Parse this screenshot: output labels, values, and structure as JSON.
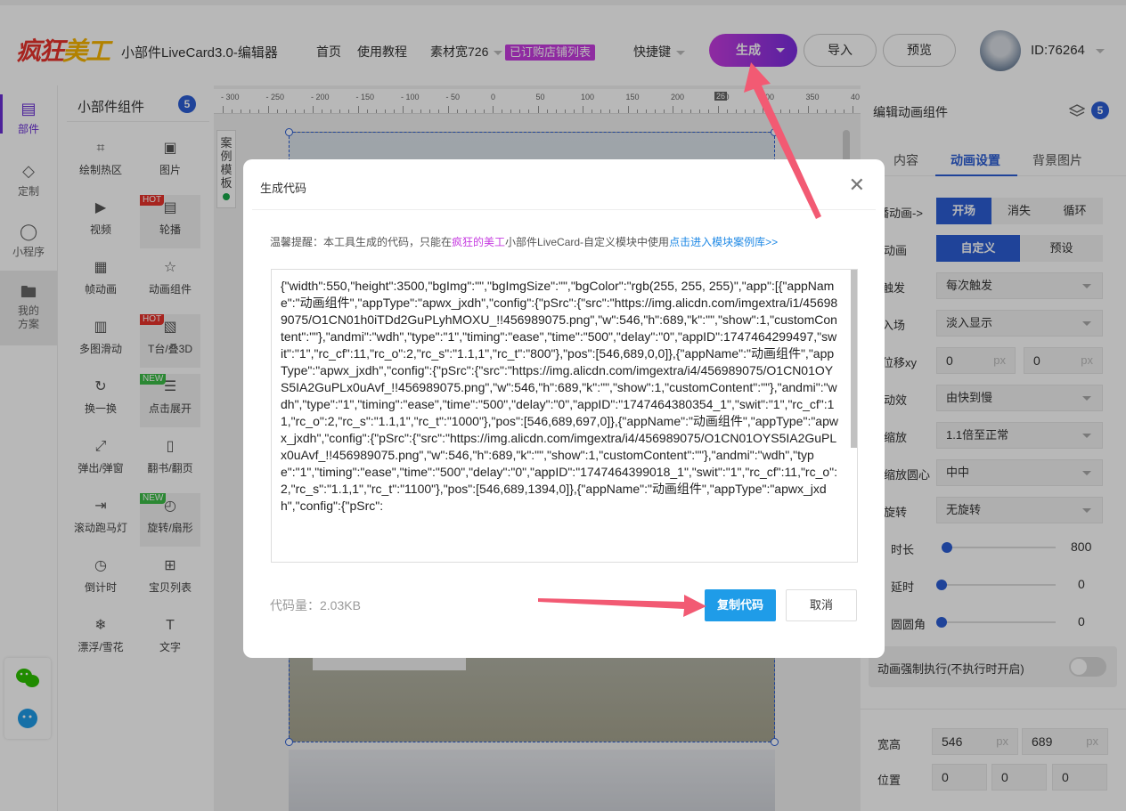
{
  "header": {
    "logo_text_a": "疯狂",
    "logo_text_b": "美工",
    "app_title": "小部件LiveCard3.0-编辑器",
    "nav": [
      "首页",
      "使用教程",
      "素材宽726"
    ],
    "subscribed_badge": "已订购店铺列表",
    "shortcut": "快捷键",
    "generate_label": "生成",
    "import_label": "导入",
    "preview_label": "预览",
    "user_id": "ID:76264"
  },
  "leftnav": {
    "items": [
      {
        "label": "部件",
        "icon": "widget-grid-icon"
      },
      {
        "label": "定制",
        "icon": "diamond-icon"
      },
      {
        "label": "小程序",
        "icon": "miniprogram-icon"
      },
      {
        "label": "我的方案",
        "icon": "folder-icon"
      }
    ]
  },
  "widgets": {
    "title": "小部件组件",
    "count": "5",
    "items": [
      {
        "label": "绘制热区",
        "icon": "hotspot-icon",
        "tag": ""
      },
      {
        "label": "图片",
        "icon": "image-icon",
        "tag": ""
      },
      {
        "label": "视频",
        "icon": "video-icon",
        "tag": ""
      },
      {
        "label": "轮播",
        "icon": "carousel-icon",
        "tag": "HOT"
      },
      {
        "label": "帧动画",
        "icon": "frame-animation-icon",
        "tag": ""
      },
      {
        "label": "动画组件",
        "icon": "star-icon",
        "tag": ""
      },
      {
        "label": "多图滑动",
        "icon": "multi-slide-icon",
        "tag": ""
      },
      {
        "label": "T台/叠3D",
        "icon": "stage-3d-icon",
        "tag": "HOT"
      },
      {
        "label": "换一换",
        "icon": "refresh-icon",
        "tag": ""
      },
      {
        "label": "点击展开",
        "icon": "expand-icon",
        "tag": "NEW"
      },
      {
        "label": "弹出/弹窗",
        "icon": "popup-icon",
        "tag": ""
      },
      {
        "label": "翻书/翻页",
        "icon": "book-icon",
        "tag": ""
      },
      {
        "label": "滚动跑马灯",
        "icon": "marquee-icon",
        "tag": ""
      },
      {
        "label": "旋转/扇形",
        "icon": "rotate-icon",
        "tag": "NEW"
      },
      {
        "label": "倒计时",
        "icon": "clock-icon",
        "tag": ""
      },
      {
        "label": "宝贝列表",
        "icon": "product-list-icon",
        "tag": ""
      },
      {
        "label": "漂浮/雪花",
        "icon": "snowflake-icon",
        "tag": ""
      },
      {
        "label": "文字",
        "icon": "text-icon",
        "tag": ""
      }
    ]
  },
  "ruler": {
    "ticks": [
      "- 300",
      "- 250",
      "- 200",
      "- 150",
      "- 100",
      "- 50",
      "0",
      "50",
      "100",
      "150",
      "200",
      "250",
      "300",
      "350",
      "40"
    ],
    "marker": "26"
  },
  "side_tab": "案例模板",
  "right": {
    "title": "编辑动画组件",
    "count": "5",
    "tabs": [
      "内容",
      "动画设置",
      "背景图片"
    ],
    "rows": [
      {
        "label": "播动画->",
        "seg": [
          "开场",
          "消失",
          "循环"
        ]
      },
      {
        "label": "动画",
        "seg": [
          "自定义",
          "预设"
        ]
      },
      {
        "label": "触发",
        "select": "每次触发"
      },
      {
        "label": "入场",
        "select": "淡入显示"
      },
      {
        "label": "位移xy",
        "x": "0",
        "y": "0",
        "unit": "px"
      },
      {
        "label": "动效",
        "select": "由快到慢"
      },
      {
        "label": "缩放",
        "select": "1.1倍至正常"
      },
      {
        "label": "缩放圆心",
        "select": "中中"
      },
      {
        "label": "旋转",
        "select": "无旋转"
      },
      {
        "label": "时长",
        "value": "800"
      },
      {
        "label": "延时",
        "value": "0"
      },
      {
        "label": "圆圆角",
        "value": "0"
      }
    ],
    "force_label": "动画强制执行(不执行时开启)",
    "size_label": "宽高",
    "width": "546",
    "height": "689",
    "pos_label": "位置",
    "pos": [
      "0",
      "0",
      "0"
    ]
  },
  "modal": {
    "title": "生成代码",
    "tip_prefix": "温馨提醒：本工具生成的代码，只能在",
    "tip_brand": "疯狂的美工",
    "tip_middle": "小部件LiveCard-自定义模块中使用",
    "tip_link": "点击进入模块案例库>>",
    "code": "{\"width\":550,\"height\":3500,\"bgImg\":\"\",\"bgImgSize\":\"\",\"bgColor\":\"rgb(255, 255, 255)\",\"app\":[{\"appName\":\"动画组件\",\"appType\":\"apwx_jxdh\",\"config\":{\"pSrc\":{\"src\":\"https://img.alicdn.com/imgextra/i1/456989075/O1CN01h0iTDd2GuPLyhMOXU_!!456989075.png\",\"w\":546,\"h\":689,\"k\":\"\",\"show\":1,\"customContent\":\"\"},\"andmi\":\"wdh\",\"type\":\"1\",\"timing\":\"ease\",\"time\":\"500\",\"delay\":\"0\",\"appID\":1747464299497,\"swit\":\"1\",\"rc_cf\":11,\"rc_o\":2,\"rc_s\":\"1.1,1\",\"rc_t\":\"800\"},\"pos\":[546,689,0,0]},{\"appName\":\"动画组件\",\"appType\":\"apwx_jxdh\",\"config\":{\"pSrc\":{\"src\":\"https://img.alicdn.com/imgextra/i4/456989075/O1CN01OYS5IA2GuPLx0uAvf_!!456989075.png\",\"w\":546,\"h\":689,\"k\":\"\",\"show\":1,\"customContent\":\"\"},\"andmi\":\"wdh\",\"type\":\"1\",\"timing\":\"ease\",\"time\":\"500\",\"delay\":\"0\",\"appID\":\"1747464380354_1\",\"swit\":\"1\",\"rc_cf\":11,\"rc_o\":2,\"rc_s\":\"1.1,1\",\"rc_t\":\"1000\"},\"pos\":[546,689,697,0]},{\"appName\":\"动画组件\",\"appType\":\"apwx_jxdh\",\"config\":{\"pSrc\":{\"src\":\"https://img.alicdn.com/imgextra/i4/456989075/O1CN01OYS5IA2GuPLx0uAvf_!!456989075.png\",\"w\":546,\"h\":689,\"k\":\"\",\"show\":1,\"customContent\":\"\"},\"andmi\":\"wdh\",\"type\":\"1\",\"timing\":\"ease\",\"time\":\"500\",\"delay\":\"0\",\"appID\":\"1747464399018_1\",\"swit\":\"1\",\"rc_cf\":11,\"rc_o\":2,\"rc_s\":\"1.1,1\",\"rc_t\":\"1100\"},\"pos\":[546,689,1394,0]},{\"appName\":\"动画组件\",\"appType\":\"apwx_jxdh\",\"config\":{\"pSrc\":",
    "size_label": "代码量：2.03KB",
    "copy_label": "复制代码",
    "cancel_label": "取消"
  },
  "colors": {
    "accent": "#2b5ed4",
    "brand_purple": "#c63ce0",
    "copy_button": "#1f9ce8",
    "annotation_arrow": "#f25a73"
  }
}
